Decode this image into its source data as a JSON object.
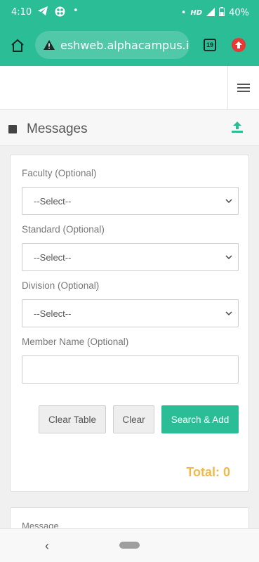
{
  "status_bar": {
    "time": "4:10",
    "network": "HD",
    "battery": "40%"
  },
  "browser": {
    "url": "eshweb.alphacampus.in",
    "tab_count": "19"
  },
  "page": {
    "title": "Messages"
  },
  "form": {
    "faculty_label": "Faculty (Optional)",
    "faculty_value": "--Select--",
    "standard_label": "Standard (Optional)",
    "standard_value": "--Select--",
    "division_label": "Division (Optional)",
    "division_value": "--Select--",
    "member_label": "Member Name (Optional)",
    "member_value": "",
    "clear_table_label": "Clear Table",
    "clear_label": "Clear",
    "search_add_label": "Search & Add",
    "total_text": "Total: 0"
  },
  "message_card": {
    "label": "Message"
  },
  "colors": {
    "accent": "#2bbd96",
    "total": "#f0b94a"
  }
}
